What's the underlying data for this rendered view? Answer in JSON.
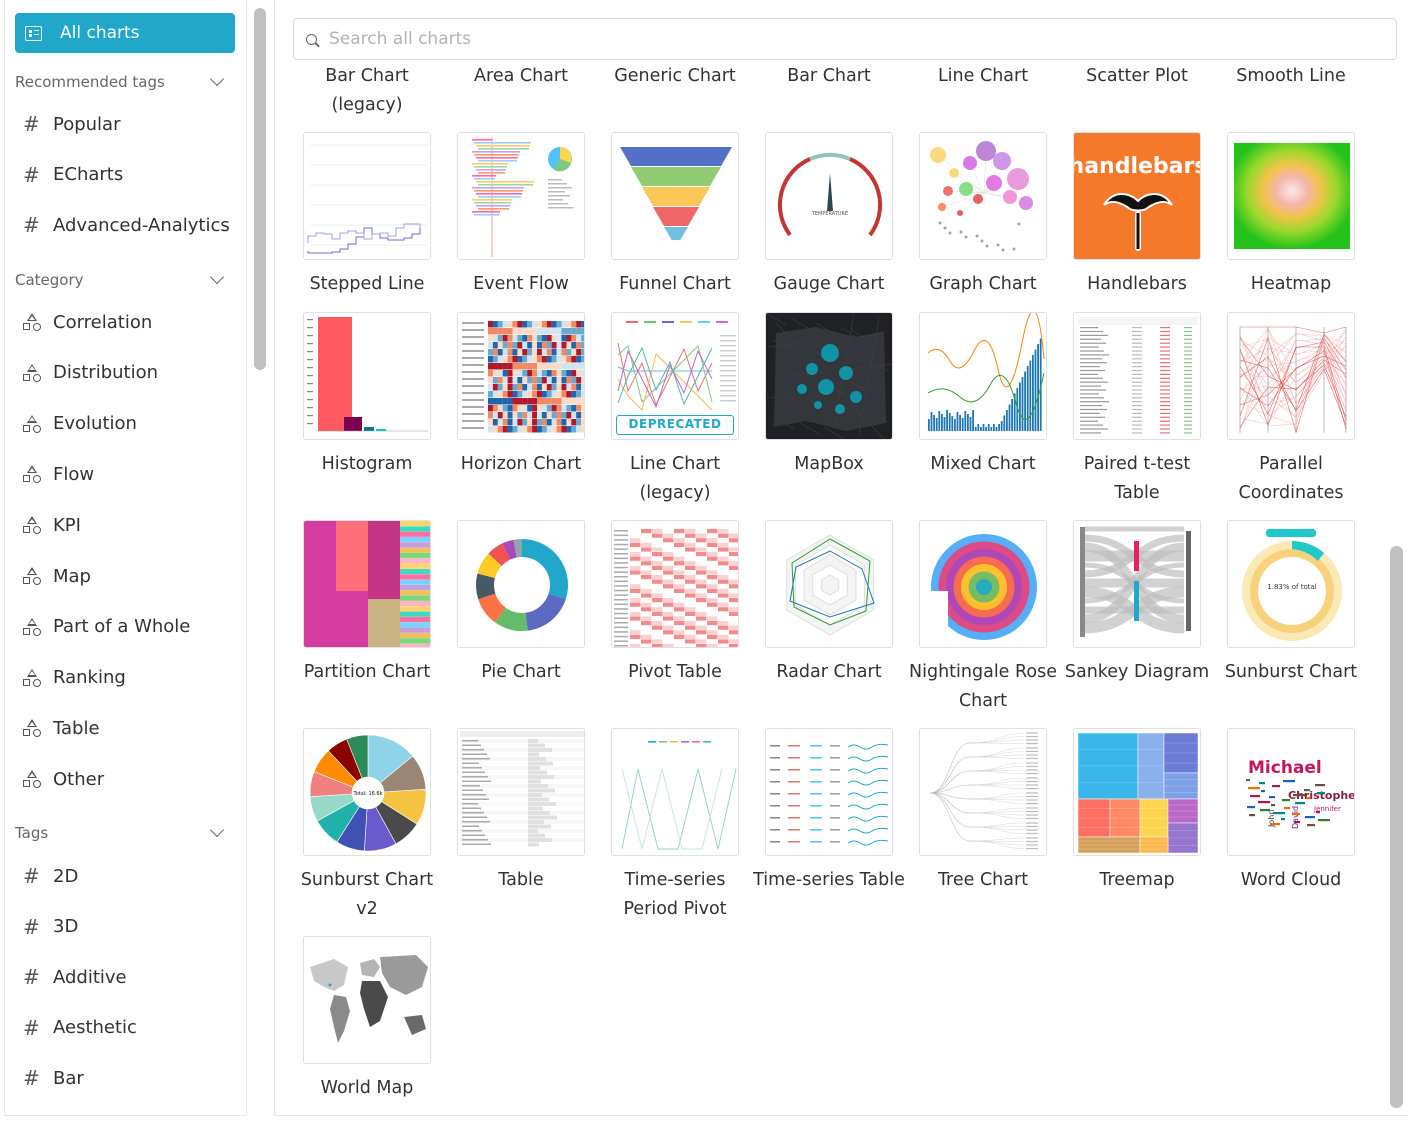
{
  "sidebar": {
    "all_charts_label": "All charts",
    "recommended_header": "Recommended tags",
    "recommended": [
      "Popular",
      "ECharts",
      "Advanced-Analytics"
    ],
    "category_header": "Category",
    "categories": [
      "Correlation",
      "Distribution",
      "Evolution",
      "Flow",
      "KPI",
      "Map",
      "Part of a Whole",
      "Ranking",
      "Table",
      "Other"
    ],
    "tags_header": "Tags",
    "tags": [
      "2D",
      "3D",
      "Additive",
      "Aesthetic",
      "Bar"
    ]
  },
  "search": {
    "placeholder": "Search all charts",
    "value": ""
  },
  "top_labels": [
    "Bar Chart (legacy)",
    "Area Chart",
    "Generic Chart",
    "Bar Chart",
    "Line Chart",
    "Scatter Plot",
    "Smooth Line"
  ],
  "charts": [
    {
      "label": "Stepped Line",
      "thumb": "stepped"
    },
    {
      "label": "Event Flow",
      "thumb": "eventflow"
    },
    {
      "label": "Funnel Chart",
      "thumb": "funnel"
    },
    {
      "label": "Gauge Chart",
      "thumb": "gauge"
    },
    {
      "label": "Graph Chart",
      "thumb": "graph"
    },
    {
      "label": "Handlebars",
      "thumb": "handlebars"
    },
    {
      "label": "Heatmap",
      "thumb": "heatmap"
    },
    {
      "label": "Histogram",
      "thumb": "histogram"
    },
    {
      "label": "Horizon Chart",
      "thumb": "horizon"
    },
    {
      "label": "Line Chart (legacy)",
      "thumb": "linelegacy",
      "badge": "DEPRECATED"
    },
    {
      "label": "MapBox",
      "thumb": "mapbox"
    },
    {
      "label": "Mixed Chart",
      "thumb": "mixed"
    },
    {
      "label": "Paired t-test Table",
      "thumb": "paired"
    },
    {
      "label": "Parallel Coordinates",
      "thumb": "parallel"
    },
    {
      "label": "Partition Chart",
      "thumb": "partition"
    },
    {
      "label": "Pie Chart",
      "thumb": "pie"
    },
    {
      "label": "Pivot Table",
      "thumb": "pivot"
    },
    {
      "label": "Radar Chart",
      "thumb": "radar"
    },
    {
      "label": "Nightingale Rose Chart",
      "thumb": "rose"
    },
    {
      "label": "Sankey Diagram",
      "thumb": "sankey"
    },
    {
      "label": "Sunburst Chart",
      "thumb": "sunburst"
    },
    {
      "label": "Sunburst Chart v2",
      "thumb": "sunburst2"
    },
    {
      "label": "Table",
      "thumb": "table"
    },
    {
      "label": "Time-series Period Pivot",
      "thumb": "tsperiod"
    },
    {
      "label": "Time-series Table",
      "thumb": "tstable"
    },
    {
      "label": "Tree Chart",
      "thumb": "tree"
    },
    {
      "label": "Treemap",
      "thumb": "treemap"
    },
    {
      "label": "Word Cloud",
      "thumb": "wordcloud"
    },
    {
      "label": "World Map",
      "thumb": "worldmap"
    }
  ],
  "thumb_text": {
    "handlebars": "handlebars",
    "gauge_caption": "TEMPERATURE",
    "sunburst_center": "1.83% of total",
    "sunburst2_center": "Total: 16.6k",
    "wordcloud_words": [
      "Michael",
      "Christopher",
      "Jennifer",
      "David",
      "John"
    ]
  },
  "colors": {
    "accent": "#20a7c9",
    "scrollbar": "#c1c1c1"
  }
}
